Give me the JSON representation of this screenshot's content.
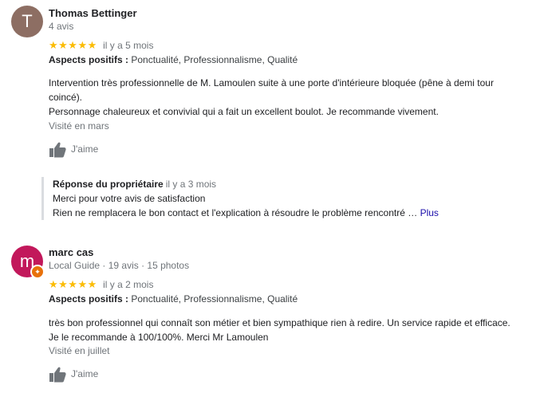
{
  "reviews": [
    {
      "avatar_letter": "T",
      "avatar_color": "#8d6e63",
      "author": "Thomas Bettinger",
      "author_meta": "4 avis",
      "stars": "★★★★★",
      "rating": 5,
      "time": "il y a 5 mois",
      "aspects_label": "Aspects positifs :",
      "aspects_values": "Ponctualité, Professionnalisme, Qualité",
      "text_line1": "Intervention très professionnelle de M. Lamoulen suite à une porte d'intérieure bloquée (pêne à demi tour coincé).",
      "text_line2": "Personnage chaleureux et convivial qui a fait un excellent boulot. Je recommande vivement.",
      "visited": "Visité en mars",
      "like_label": "J'aime"
    },
    {
      "avatar_letter": "m",
      "avatar_color": "#c2185b",
      "author": "marc cas",
      "author_meta": "Local Guide · 19 avis · 15 photos",
      "stars": "★★★★★",
      "rating": 5,
      "time": "il y a 2 mois",
      "aspects_label": "Aspects positifs :",
      "aspects_values": "Ponctualité, Professionnalisme, Qualité",
      "text_line1": "très bon professionnel qui connaît son métier et bien sympathique rien à redire. Un service rapide et efficace. Je le recommande à 100/100%. Merci Mr Lamoulen",
      "visited": "Visité en juillet",
      "like_label": "J'aime"
    }
  ],
  "owner_reply": {
    "title": "Réponse du propriétaire",
    "time": "il y a 3 mois",
    "line1": "Merci pour votre avis de satisfaction",
    "line2": "Rien ne remplacera le bon contact et l'explication à résoudre le problème rencontré …",
    "more_label": "Plus"
  },
  "colors": {
    "star": "#fbbc04",
    "link": "#1a0dab",
    "local_guide_badge": "#e8710a"
  }
}
